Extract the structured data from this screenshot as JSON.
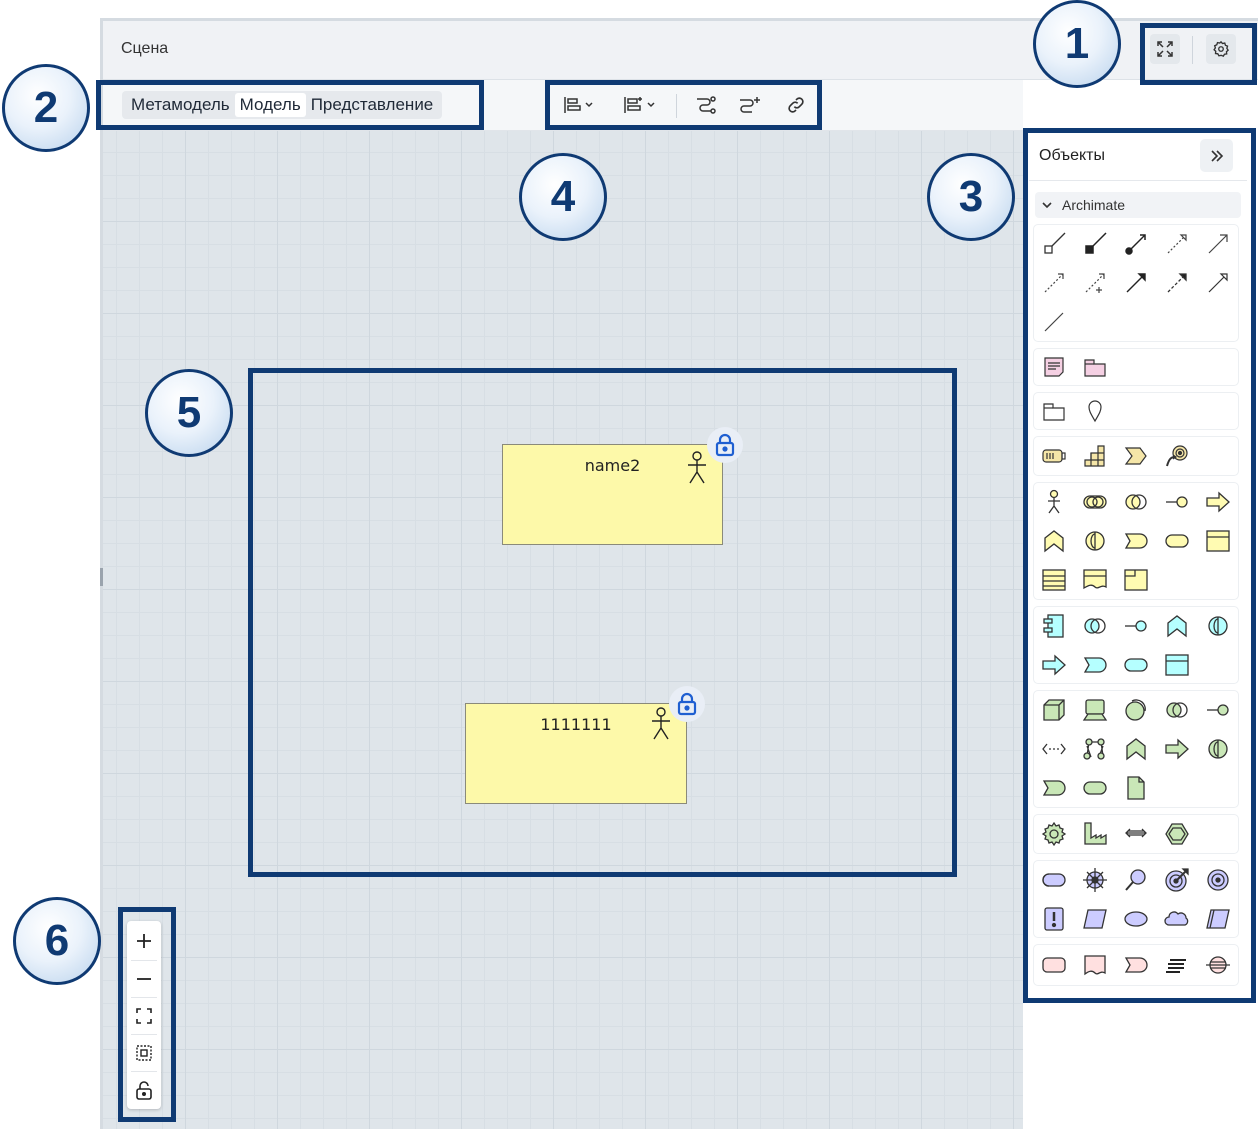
{
  "scene": {
    "title": "Сцена",
    "header_buttons": [
      {
        "icon": "fullscreen-icon"
      },
      {
        "icon": "gear-icon"
      }
    ]
  },
  "mode_tabs": {
    "items": [
      "Метамодель",
      "Модель",
      "Представление"
    ],
    "active": "Модель"
  },
  "toolbar": {
    "items": [
      {
        "icon": "align-left-icon",
        "has_dropdown": true
      },
      {
        "icon": "align-distribute-icon",
        "has_dropdown": true
      },
      {
        "icon": "route-path-icon"
      },
      {
        "icon": "route-path-add-icon"
      },
      {
        "icon": "link-icon"
      }
    ]
  },
  "objects_panel": {
    "title": "Объекты",
    "group_name": "Archimate",
    "colors": {
      "strategy": "#f5e6a8",
      "business": "#fffbb2",
      "application": "#b5ffff",
      "technology": "#c9e7b7",
      "motivation": "#ccccff",
      "implementation": "#ffe0e0",
      "other": "#f5d0e3"
    }
  },
  "canvas": {
    "nodes": [
      {
        "name": "name2",
        "icon": "actor-icon",
        "locked": true
      },
      {
        "name": "1111111",
        "icon": "actor-icon",
        "locked": true
      }
    ]
  },
  "zoom_controls": [
    {
      "icon": "zoom-in-icon"
    },
    {
      "icon": "zoom-out-icon"
    },
    {
      "icon": "fit-screen-icon"
    },
    {
      "icon": "fit-selection-icon"
    },
    {
      "icon": "unlock-icon"
    }
  ],
  "annotations": [
    "1",
    "2",
    "3",
    "4",
    "5",
    "6"
  ],
  "colors": {
    "highlight_border": "#0f3a73",
    "node_fill": "#fdf9a9",
    "lock_blue": "#1f5fd1",
    "canvas_bg": "#dfe5ea"
  }
}
